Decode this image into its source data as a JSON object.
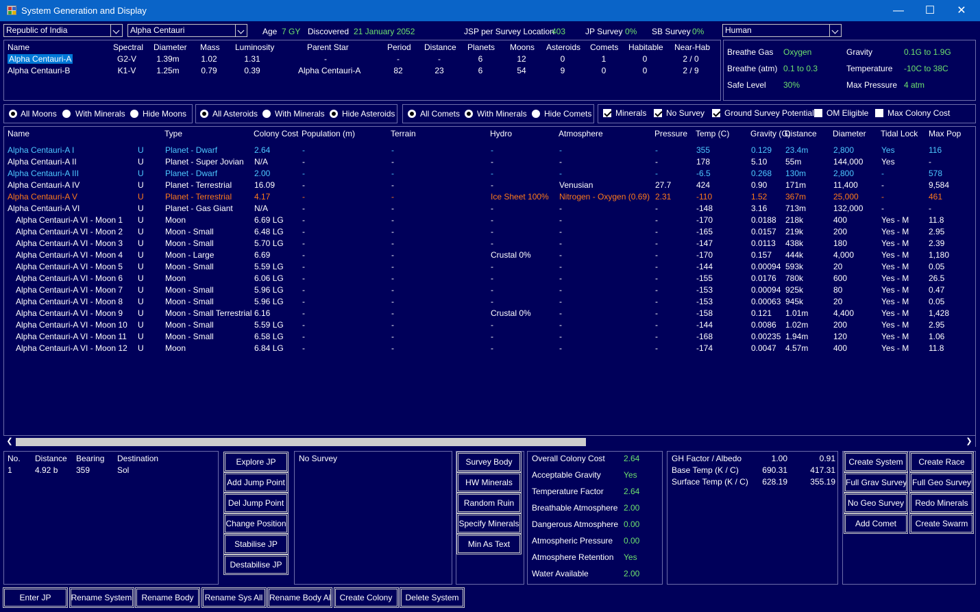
{
  "window": {
    "title": "System Generation and Display",
    "minimize": "—",
    "maximize": "☐",
    "close": "✕"
  },
  "top": {
    "race_combo": "Republic of India",
    "system_combo": "Alpha Centauri",
    "age_label": "Age",
    "age_value": "7 GY",
    "discovered_label": "Discovered",
    "discovered_value": "21 January 2052",
    "jsp_label": "JSP per Survey Location",
    "jsp_value": "403",
    "jp_label": "JP Survey",
    "jp_value": "0%",
    "sb_label": "SB Survey",
    "sb_value": "0%",
    "species_combo": "Human"
  },
  "stars": {
    "headers": [
      "Name",
      "Spectral",
      "Diameter",
      "Mass",
      "Luminosity",
      "Parent Star",
      "Period",
      "Distance",
      "Planets",
      "Moons",
      "Asteroids",
      "Comets",
      "Habitable",
      "Near-Hab"
    ],
    "rows": [
      [
        "Alpha Centauri-A",
        "G2-V",
        "1.39m",
        "1.02",
        "1.31",
        "-",
        "-",
        "-",
        "6",
        "12",
        "0",
        "1",
        "0",
        "2 / 0"
      ],
      [
        "Alpha Centauri-B",
        "K1-V",
        "1.25m",
        "0.79",
        "0.39",
        "Alpha Centauri-A",
        "82",
        "23",
        "6",
        "54",
        "9",
        "0",
        "0",
        "2 / 9"
      ]
    ]
  },
  "environment": {
    "breathe_gas_label": "Breathe Gas",
    "breathe_gas_value": "Oxygen",
    "gravity_label": "Gravity",
    "gravity_value": "0.1G  to  1.9G",
    "breathe_atm_label": "Breathe (atm)",
    "breathe_atm_value": "0.1  to  0.3",
    "temperature_label": "Temperature",
    "temperature_value": "-10C  to  38C",
    "safe_level_label": "Safe Level",
    "safe_level_value": "30%",
    "max_pressure_label": "Max Pressure",
    "max_pressure_value": "4 atm"
  },
  "filters": {
    "moons": [
      "All Moons",
      "With Minerals",
      "Hide Moons"
    ],
    "asteroids": [
      "All Asteroids",
      "With Minerals",
      "Hide Asteroids"
    ],
    "comets": [
      "All Comets",
      "With Minerals",
      "Hide Comets"
    ],
    "checks": [
      "Minerals",
      "No Survey",
      "Ground Survey Potential",
      "OM Eligible",
      "Max Colony Cost"
    ]
  },
  "bodies": {
    "headers": [
      "Name",
      "Type",
      "Colony Cost",
      "Population (m)",
      "Terrain",
      "Hydro",
      "Atmosphere",
      "Pressure",
      "Temp (C)",
      "Gravity (G)",
      "Distance",
      "Diameter",
      "Tidal Lock",
      "Max Pop"
    ],
    "rows": [
      {
        "cls": "c",
        "v": [
          "Alpha Centauri-A I",
          "U",
          "Planet - Dwarf",
          "2.64",
          "-",
          "-",
          "-",
          "-",
          "-",
          "355",
          "0.129",
          "23.4m",
          "2,800",
          "Yes",
          "116"
        ]
      },
      {
        "cls": "",
        "v": [
          "Alpha Centauri-A II",
          "U",
          "Planet - Super Jovian",
          "N/A",
          "-",
          "-",
          "-",
          "-",
          "-",
          "178",
          "5.10",
          "55m",
          "144,000",
          "Yes",
          "-"
        ]
      },
      {
        "cls": "c",
        "v": [
          "Alpha Centauri-A III",
          "U",
          "Planet - Dwarf",
          "2.00",
          "-",
          "-",
          "-",
          "-",
          "-",
          "-6.5",
          "0.268",
          "130m",
          "2,800",
          "-",
          "578"
        ]
      },
      {
        "cls": "",
        "v": [
          "Alpha Centauri-A IV",
          "U",
          "Planet - Terrestrial",
          "16.09",
          "-",
          "-",
          "-",
          "Venusian",
          "27.7",
          "424",
          "0.90",
          "171m",
          "11,400",
          "-",
          "9,584"
        ]
      },
      {
        "cls": "o",
        "v": [
          "Alpha Centauri-A V",
          "U",
          "Planet - Terrestrial",
          "4.17",
          "-",
          "-",
          "Ice Sheet 100%",
          "Nitrogen - Oxygen (0.69)",
          "2.31",
          "-110",
          "1.52",
          "367m",
          "25,000",
          "-",
          "461"
        ]
      },
      {
        "cls": "",
        "v": [
          "Alpha Centauri-A VI",
          "U",
          "Planet - Gas Giant",
          "N/A",
          "-",
          "-",
          "-",
          "-",
          "-",
          "-148",
          "3.16",
          "713m",
          "132,000",
          "-",
          "-"
        ]
      },
      {
        "cls": "",
        "v": [
          "Alpha Centauri-A VI - Moon 1",
          "U",
          "Moon",
          "6.69 LG",
          "-",
          "-",
          "-",
          "-",
          "-",
          "-170",
          "0.0188",
          "218k",
          "400",
          "Yes - M",
          "11.8"
        ]
      },
      {
        "cls": "",
        "v": [
          "Alpha Centauri-A VI - Moon 2",
          "U",
          "Moon - Small",
          "6.48 LG",
          "-",
          "-",
          "-",
          "-",
          "-",
          "-165",
          "0.0157",
          "219k",
          "200",
          "Yes - M",
          "2.95"
        ]
      },
      {
        "cls": "",
        "v": [
          "Alpha Centauri-A VI - Moon 3",
          "U",
          "Moon - Small",
          "5.70 LG",
          "-",
          "-",
          "-",
          "-",
          "-",
          "-147",
          "0.0113",
          "438k",
          "180",
          "Yes - M",
          "2.39"
        ]
      },
      {
        "cls": "",
        "v": [
          "Alpha Centauri-A VI - Moon 4",
          "U",
          "Moon - Large",
          "6.69",
          "-",
          "-",
          "Crustal 0%",
          "-",
          "-",
          "-170",
          "0.157",
          "444k",
          "4,000",
          "Yes - M",
          "1,180"
        ]
      },
      {
        "cls": "",
        "v": [
          "Alpha Centauri-A VI - Moon 5",
          "U",
          "Moon - Small",
          "5.59 LG",
          "-",
          "-",
          "-",
          "-",
          "-",
          "-144",
          "0.00094",
          "593k",
          "20",
          "Yes - M",
          "0.05"
        ]
      },
      {
        "cls": "",
        "v": [
          "Alpha Centauri-A VI - Moon 6",
          "U",
          "Moon",
          "6.06 LG",
          "-",
          "-",
          "-",
          "-",
          "-",
          "-155",
          "0.0176",
          "780k",
          "600",
          "Yes - M",
          "26.5"
        ]
      },
      {
        "cls": "",
        "v": [
          "Alpha Centauri-A VI - Moon 7",
          "U",
          "Moon - Small",
          "5.96 LG",
          "-",
          "-",
          "-",
          "-",
          "-",
          "-153",
          "0.00094",
          "925k",
          "80",
          "Yes - M",
          "0.47"
        ]
      },
      {
        "cls": "",
        "v": [
          "Alpha Centauri-A VI - Moon 8",
          "U",
          "Moon - Small",
          "5.96 LG",
          "-",
          "-",
          "-",
          "-",
          "-",
          "-153",
          "0.00063",
          "945k",
          "20",
          "Yes - M",
          "0.05"
        ]
      },
      {
        "cls": "",
        "v": [
          "Alpha Centauri-A VI - Moon 9",
          "U",
          "Moon - Small Terrestrial",
          "6.16",
          "-",
          "-",
          "Crustal 0%",
          "-",
          "-",
          "-158",
          "0.121",
          "1.01m",
          "4,400",
          "Yes - M",
          "1,428"
        ]
      },
      {
        "cls": "",
        "v": [
          "Alpha Centauri-A VI - Moon 10",
          "U",
          "Moon - Small",
          "5.59 LG",
          "-",
          "-",
          "-",
          "-",
          "-",
          "-144",
          "0.0086",
          "1.02m",
          "200",
          "Yes - M",
          "2.95"
        ]
      },
      {
        "cls": "",
        "v": [
          "Alpha Centauri-A VI - Moon 11",
          "U",
          "Moon - Small",
          "6.58 LG",
          "-",
          "-",
          "-",
          "-",
          "-",
          "-168",
          "0.00235",
          "1.94m",
          "120",
          "Yes - M",
          "1.06"
        ]
      },
      {
        "cls": "",
        "v": [
          "Alpha Centauri-A VI - Moon 12",
          "U",
          "Moon",
          "6.84 LG",
          "-",
          "-",
          "-",
          "-",
          "-",
          "-174",
          "0.0047",
          "4.57m",
          "400",
          "Yes - M",
          "11.8"
        ]
      }
    ]
  },
  "jump_points": {
    "headers": [
      "No.",
      "Distance",
      "Bearing",
      "Destination"
    ],
    "rows": [
      [
        "1",
        "4.92 b",
        "359",
        "Sol"
      ]
    ]
  },
  "jp_buttons": [
    "Explore JP",
    "Add Jump Point",
    "Del Jump Point",
    "Change Position",
    "Stabilise JP",
    "Destabilise JP"
  ],
  "survey_text": "No Survey",
  "survey_buttons": [
    "Survey Body",
    "HW Minerals",
    "Random Ruin",
    "Specify Minerals",
    "Min As Text"
  ],
  "colony_cost": [
    [
      "Overall Colony Cost",
      "2.64"
    ],
    [
      "Acceptable Gravity",
      "Yes"
    ],
    [
      "Temperature Factor",
      "2.64"
    ],
    [
      "Breathable Atmosphere",
      "2.00"
    ],
    [
      "Dangerous Atmosphere",
      "0.00"
    ],
    [
      "Atmospheric Pressure",
      "0.00"
    ],
    [
      "Atmosphere Retention",
      "Yes"
    ],
    [
      "Water Available",
      "2.00"
    ]
  ],
  "gh": [
    [
      "GH Factor / Albedo",
      "1.00",
      "0.91"
    ],
    [
      "Base Temp (K / C)",
      "690.31",
      "417.31"
    ],
    [
      "Surface Temp (K / C)",
      "628.19",
      "355.19"
    ]
  ],
  "right_buttons": [
    "Create System",
    "Create Race",
    "Full Grav Survey",
    "Full Geo Survey",
    "No Geo Survey",
    "Redo Minerals",
    "Add Comet",
    "Create Swarm"
  ],
  "bottom_buttons": [
    "Enter JP",
    "Rename System",
    "Rename Body",
    "Rename Sys All",
    "Rename Body All",
    "Create Colony",
    "Delete System"
  ]
}
